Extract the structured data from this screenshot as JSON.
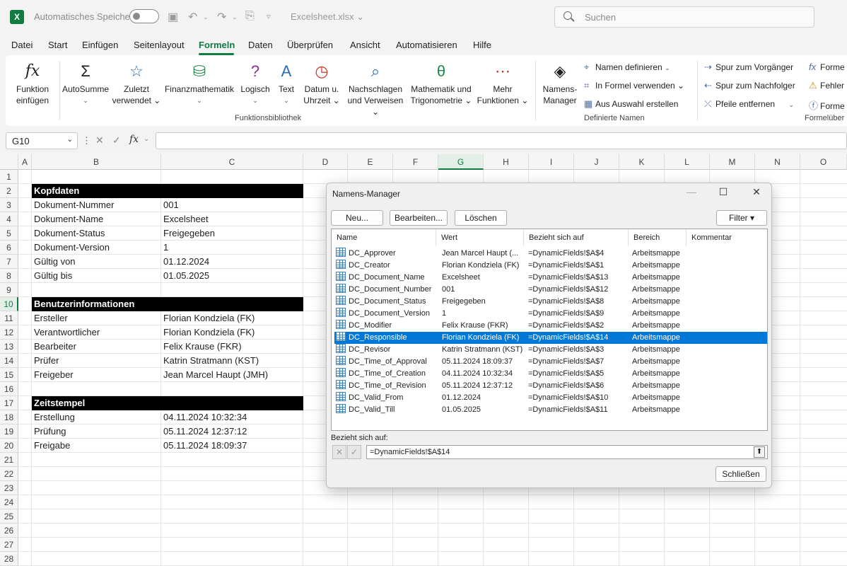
{
  "titlebar": {
    "autosave_label": "Automatisches Speichern",
    "filename": "Excelsheet.xlsx ⌄",
    "search_placeholder": "Suchen",
    "logo": "X"
  },
  "menu": [
    "Datei",
    "Start",
    "Einfügen",
    "Seitenlayout",
    "Formeln",
    "Daten",
    "Überprüfen",
    "Ansicht",
    "Automatisieren",
    "Hilfe"
  ],
  "ribbon": {
    "func_insert": [
      "Funktion",
      "einfügen"
    ],
    "autosum": "AutoSumme",
    "recent": [
      "Zuletzt",
      "verwendet ⌄"
    ],
    "finance": "Finanzmathematik",
    "logic": "Logisch",
    "text": "Text",
    "datetime": [
      "Datum u.",
      "Uhrzeit ⌄"
    ],
    "lookup": [
      "Nachschlagen",
      "und Verweisen ⌄"
    ],
    "math": [
      "Mathematik und",
      "Trigonometrie ⌄"
    ],
    "more": [
      "Mehr",
      "Funktionen ⌄"
    ],
    "group_library": "Funktionsbibliothek",
    "name_manager": [
      "Namens-",
      "Manager"
    ],
    "define_name": "Namen definieren",
    "use_in_formula": "In Formel verwenden ⌄",
    "create_from_sel": "Aus Auswahl erstellen",
    "group_names": "Definierte Namen",
    "trace_prec": "Spur zum Vorgänger",
    "trace_dep": "Spur zum Nachfolger",
    "remove_arrows": "Pfeile entfernen",
    "formula_show": "Forme",
    "error_check": "Fehler",
    "formula_eval": "Forme",
    "group_audit": "Formelüber"
  },
  "formulabar": {
    "namebox": "G10",
    "fx": "fx"
  },
  "grid": {
    "columns": [
      "A",
      "B",
      "C",
      "D",
      "E",
      "F",
      "G",
      "H",
      "I",
      "J",
      "K",
      "L",
      "M",
      "N",
      "O"
    ],
    "rows": [
      "1",
      "2",
      "3",
      "4",
      "5",
      "6",
      "7",
      "8",
      "9",
      "10",
      "11",
      "12",
      "13",
      "14",
      "15",
      "16",
      "17",
      "18",
      "19",
      "20",
      "21",
      "22",
      "23",
      "24",
      "25",
      "26",
      "27",
      "28"
    ],
    "sections": {
      "kopfdaten": "Kopfdaten",
      "benutzer": "Benutzerinformationen",
      "zeitstempel": "Zeitstempel"
    },
    "kopf_rows": [
      [
        "Dokument-Nummer",
        "001"
      ],
      [
        "Dokument-Name",
        "Excelsheet"
      ],
      [
        "Dokument-Status",
        "Freigegeben"
      ],
      [
        "Dokument-Version",
        "1"
      ],
      [
        "Gültig von",
        "01.12.2024"
      ],
      [
        "Gültig bis",
        "01.05.2025"
      ]
    ],
    "benutzer_rows": [
      [
        "Ersteller",
        "Florian Kondziela (FK)"
      ],
      [
        "Verantwortlicher",
        "Florian Kondziela (FK)"
      ],
      [
        "Bearbeiter",
        "Felix Krause (FKR)"
      ],
      [
        "Prüfer",
        "Katrin Stratmann (KST)"
      ],
      [
        "Freigeber",
        "Jean Marcel Haupt (JMH)"
      ]
    ],
    "zeit_rows": [
      [
        "Erstellung",
        "04.11.2024 10:32:34"
      ],
      [
        "Prüfung",
        "05.11.2024 12:37:12"
      ],
      [
        "Freigabe",
        "05.11.2024 18:09:37"
      ]
    ]
  },
  "dialog": {
    "title": "Namens-Manager",
    "btn_new": "Neu...",
    "btn_edit": "Bearbeiten...",
    "btn_delete": "Löschen",
    "btn_filter": "Filter ▾",
    "headers": [
      "Name",
      "Wert",
      "Bezieht sich auf",
      "Bereich",
      "Kommentar"
    ],
    "rows": [
      [
        "DC_Approver",
        "Jean Marcel Haupt (...",
        "=DynamicFields!$A$4",
        "Arbeitsmappe"
      ],
      [
        "DC_Creator",
        "Florian Kondziela (FK)",
        "=DynamicFields!$A$1",
        "Arbeitsmappe"
      ],
      [
        "DC_Document_Name",
        "Excelsheet",
        "=DynamicFields!$A$13",
        "Arbeitsmappe"
      ],
      [
        "DC_Document_Number",
        "001",
        "=DynamicFields!$A$12",
        "Arbeitsmappe"
      ],
      [
        "DC_Document_Status",
        "Freigegeben",
        "=DynamicFields!$A$8",
        "Arbeitsmappe"
      ],
      [
        "DC_Document_Version",
        "1",
        "=DynamicFields!$A$9",
        "Arbeitsmappe"
      ],
      [
        "DC_Modifier",
        "Felix Krause (FKR)",
        "=DynamicFields!$A$2",
        "Arbeitsmappe"
      ],
      [
        "DC_Responsible",
        "Florian Kondziela (FK)",
        "=DynamicFields!$A$14",
        "Arbeitsmappe"
      ],
      [
        "DC_Revisor",
        "Katrin Stratmann (KST)",
        "=DynamicFields!$A$3",
        "Arbeitsmappe"
      ],
      [
        "DC_Time_of_Approval",
        "05.11.2024 18:09:37",
        "=DynamicFields!$A$7",
        "Arbeitsmappe"
      ],
      [
        "DC_Time_of_Creation",
        "04.11.2024 10:32:34",
        "=DynamicFields!$A$5",
        "Arbeitsmappe"
      ],
      [
        "DC_Time_of_Revision",
        "05.11.2024 12:37:12",
        "=DynamicFields!$A$6",
        "Arbeitsmappe"
      ],
      [
        "DC_Valid_From",
        "01.12.2024",
        "=DynamicFields!$A$10",
        "Arbeitsmappe"
      ],
      [
        "DC_Valid_Till",
        "01.05.2025",
        "=DynamicFields!$A$11",
        "Arbeitsmappe"
      ]
    ],
    "selected_index": 7,
    "ref_label": "Bezieht sich auf:",
    "ref_value": "=DynamicFields!$A$14",
    "btn_close": "Schließen"
  },
  "colors": {
    "accent": "#107c41",
    "selection": "#0078d7",
    "header_black": "#000000"
  }
}
